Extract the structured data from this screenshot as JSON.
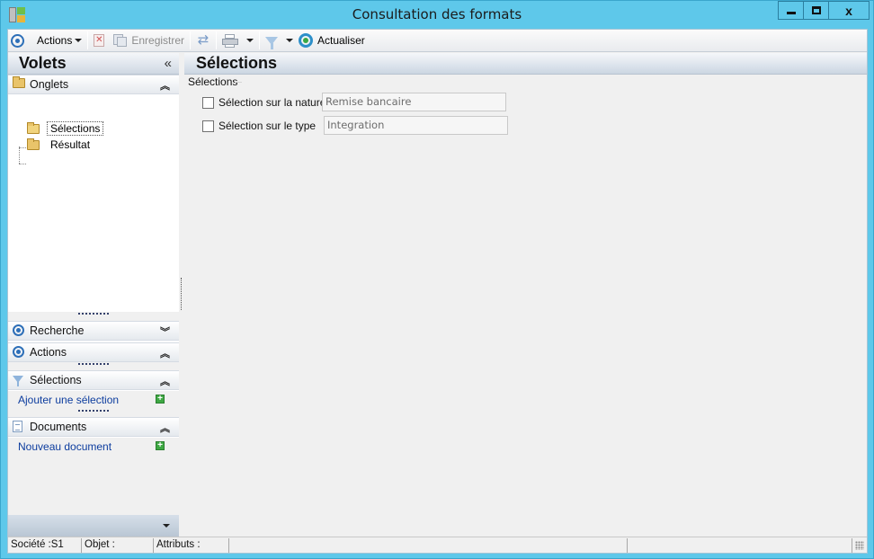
{
  "window": {
    "title": "Consultation des formats",
    "close_glyph": "x"
  },
  "toolbar": {
    "actions_label": "Actions",
    "save_label": "Enregistrer",
    "refresh_label": "Actualiser"
  },
  "left_pane": {
    "title": "Volets",
    "collapse_glyph": "«",
    "sections": {
      "onglets": {
        "label": "Onglets",
        "items": [
          "Sélections",
          "Résultat"
        ],
        "selected": "Sélections"
      },
      "recherche": {
        "label": "Recherche"
      },
      "actions": {
        "label": "Actions"
      },
      "selections": {
        "label": "Sélections",
        "link": "Ajouter une sélection"
      },
      "documents": {
        "label": "Documents",
        "link": "Nouveau document"
      }
    }
  },
  "main": {
    "title": "Sélections",
    "group_title": "Sélections",
    "fields": [
      {
        "label": "Sélection sur la nature",
        "value": "Remise bancaire",
        "checked": false
      },
      {
        "label": "Sélection sur le type",
        "value": "Integration",
        "checked": false
      }
    ]
  },
  "statusbar": {
    "societe": "Société :S1",
    "objet": "Objet :",
    "attributs": "Attributs :"
  }
}
